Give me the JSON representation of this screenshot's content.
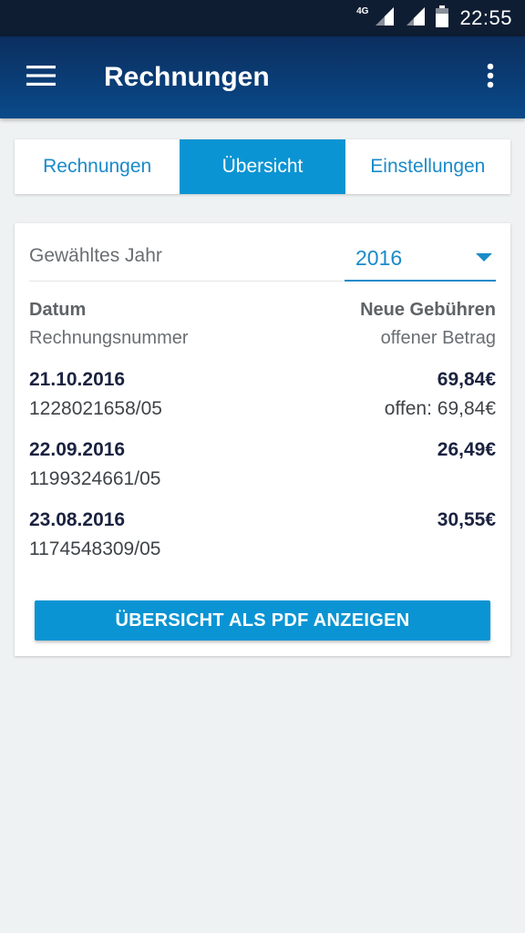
{
  "status_bar": {
    "network": "4G",
    "time": "22:55"
  },
  "app_bar": {
    "title": "Rechnungen",
    "menu_icon": "hamburger-menu-icon",
    "overflow_icon": "more-vert-icon"
  },
  "tabs": [
    {
      "label": "Rechnungen",
      "active": false
    },
    {
      "label": "Übersicht",
      "active": true
    },
    {
      "label": "Einstellungen",
      "active": false
    }
  ],
  "year_filter": {
    "label": "Gewähltes Jahr",
    "selected": "2016"
  },
  "table": {
    "header_left": "Datum",
    "header_right": "Neue Gebühren",
    "subheader_left": "Rechnungsnummer",
    "subheader_right": "offener Betrag",
    "rows": [
      {
        "date": "21.10.2016",
        "number": "1228021658/05",
        "amount": "69,84€",
        "open": "offen: 69,84€"
      },
      {
        "date": "22.09.2016",
        "number": "1199324661/05",
        "amount": "26,49€",
        "open": ""
      },
      {
        "date": "23.08.2016",
        "number": "1174548309/05",
        "amount": "30,55€",
        "open": ""
      }
    ]
  },
  "pdf_button": {
    "label": "ÜBERSICHT ALS PDF ANZEIGEN"
  },
  "colors": {
    "accent": "#0b94d3",
    "app_bar": "#0a4a8a",
    "status_bar": "#0f1d33",
    "background": "#eff2f2"
  }
}
